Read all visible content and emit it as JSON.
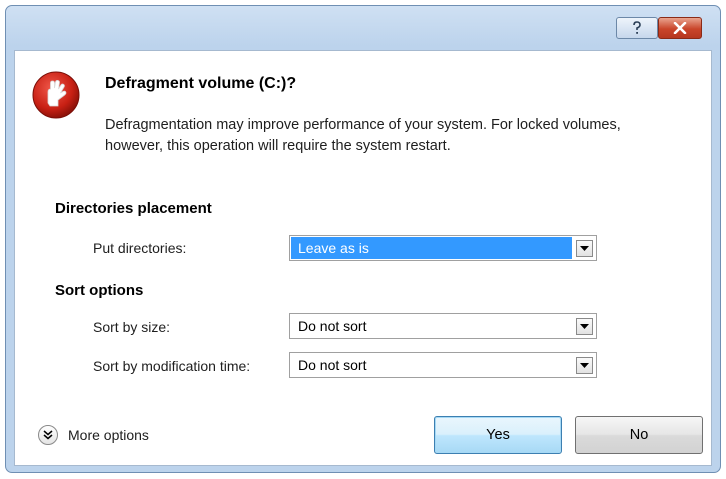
{
  "window": {
    "help_icon": "question-icon",
    "close_icon": "close-icon"
  },
  "header": {
    "icon": "defrag-warning-icon",
    "title": "Defragment volume (C:)?",
    "description": "Defragmentation may improve performance of your system. For locked volumes, however, this operation will require the system restart."
  },
  "directories_placement": {
    "heading": "Directories placement",
    "put_directories": {
      "label": "Put directories:",
      "value": "Leave as is"
    }
  },
  "sort_options": {
    "heading": "Sort options",
    "sort_by_size": {
      "label": "Sort by size:",
      "value": "Do not sort"
    },
    "sort_by_modification_time": {
      "label": "Sort by modification time:",
      "value": "Do not sort"
    }
  },
  "footer": {
    "more_options_label": "More options",
    "yes_label": "Yes",
    "no_label": "No"
  },
  "colors": {
    "selection": "#3399ff",
    "icon_red": "#c82014",
    "close_red": "#c9452a"
  }
}
